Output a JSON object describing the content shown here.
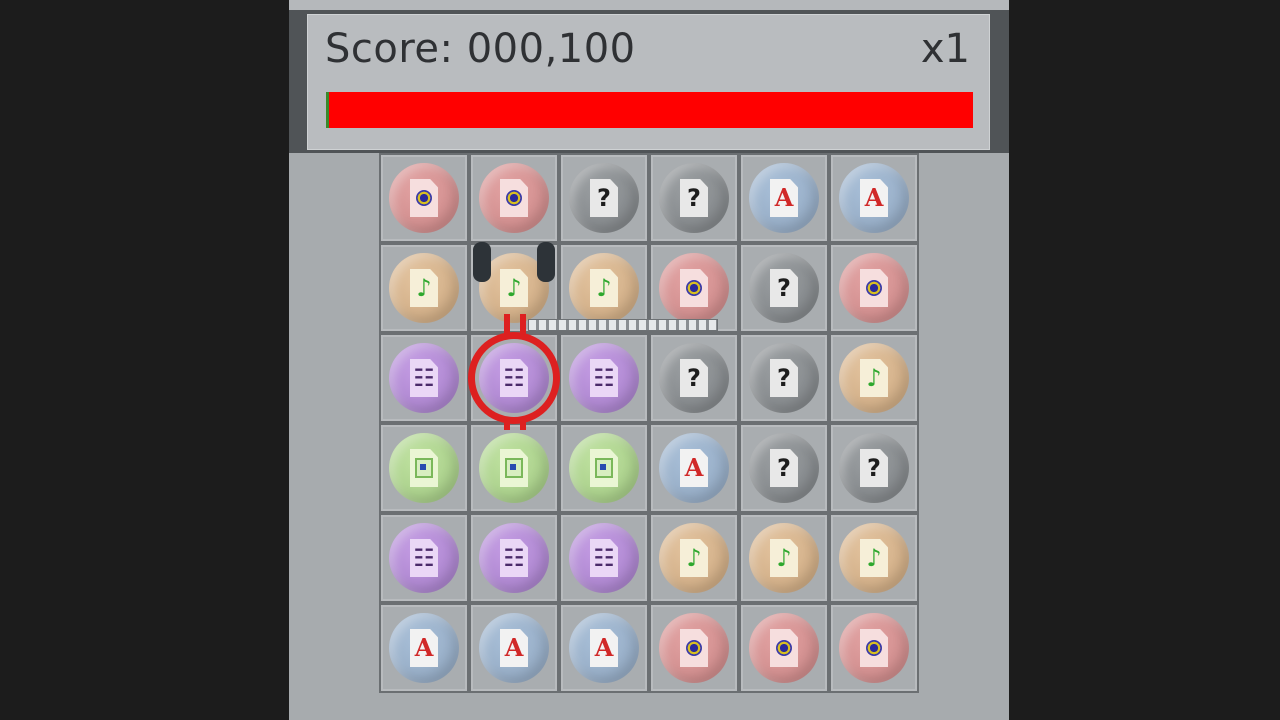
{
  "hud": {
    "score_label": "Score: 000,100",
    "multiplier": "x1",
    "timer_remaining_fraction": 0.995
  },
  "colors": {
    "timer_fill": "#ff0000",
    "timer_track": "#3a8a2a",
    "selector": "#dd2020"
  },
  "board": {
    "rows": 6,
    "cols": 6,
    "selected": {
      "row": 2,
      "col": 1
    },
    "tiles": [
      [
        "disc",
        "disc",
        "help",
        "help",
        "text",
        "text"
      ],
      [
        "music",
        "music",
        "music",
        "disc",
        "help",
        "disc"
      ],
      [
        "video",
        "video",
        "video",
        "help",
        "help",
        "music"
      ],
      [
        "image",
        "image",
        "image",
        "text",
        "help",
        "help"
      ],
      [
        "video",
        "video",
        "video",
        "music",
        "music",
        "music"
      ],
      [
        "text",
        "text",
        "text",
        "disc",
        "disc",
        "disc"
      ]
    ]
  },
  "tile_icons": {
    "disc": "disc-file-icon",
    "help": "question-file-icon",
    "text": "text-file-icon",
    "music": "music-file-icon",
    "video": "video-file-icon",
    "image": "image-file-icon"
  },
  "tile_glyphs": {
    "help": "?",
    "text": "A",
    "music": "♪",
    "video": "☷"
  }
}
